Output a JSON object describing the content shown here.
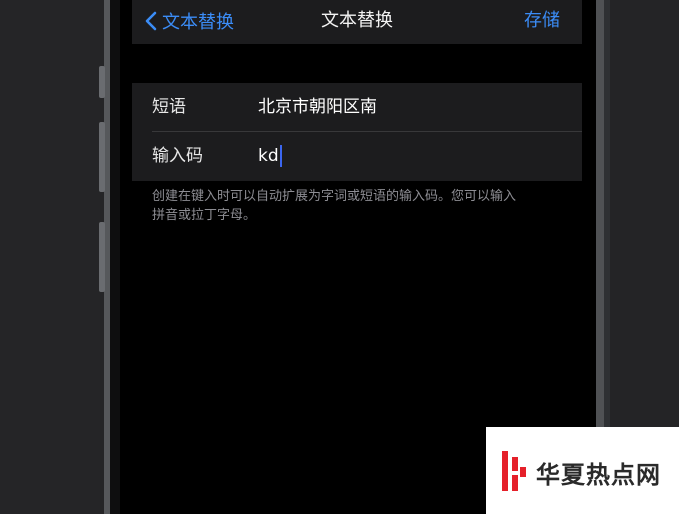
{
  "nav": {
    "back_label": "文本替换",
    "title": "文本替换",
    "save_label": "存储"
  },
  "form": {
    "phrase_label": "短语",
    "phrase_value": "北京市朝阳区南",
    "shortcut_label": "输入码",
    "shortcut_value": "kd"
  },
  "footnote": {
    "line1": "创建在键入时可以自动扩展为字词或短语的输入码。您可以输入",
    "line2": "拼音或拉丁字母。"
  },
  "watermark": {
    "text": "华夏热点网",
    "logo_icon": "hx-logo-icon",
    "accent_color": "#e5202a"
  },
  "colors": {
    "accent": "#3b8cf6",
    "caret": "#3b66f0"
  }
}
